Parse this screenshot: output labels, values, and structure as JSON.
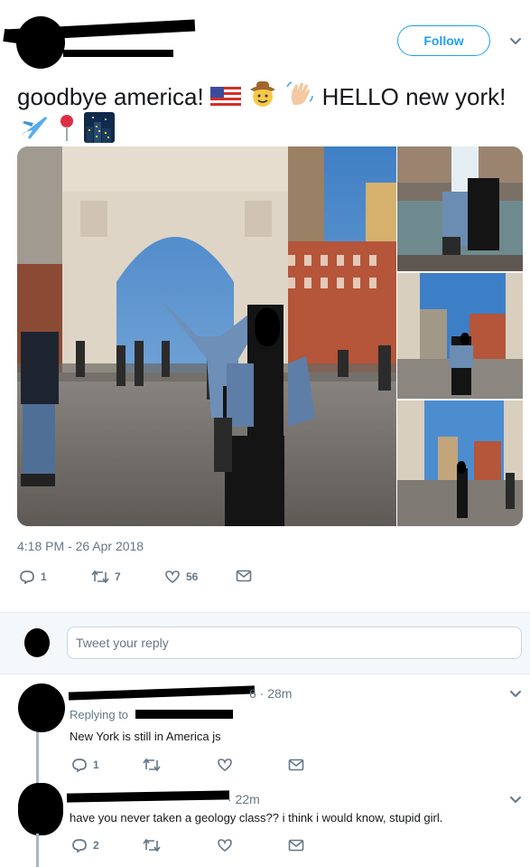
{
  "tweet": {
    "follow_label": "Follow",
    "text_a": "goodbye america! ",
    "text_b": " HELLO new york!",
    "timestamp": "4:18 PM - 26 Apr 2018",
    "reply_count": "1",
    "retweet_count": "7",
    "like_count": "56"
  },
  "reply_box": {
    "placeholder": "Tweet your reply"
  },
  "replies": [
    {
      "time": "6 · 28m",
      "replying_to_label": "Replying to",
      "text": "New York is still in America js",
      "reply_count": "1"
    },
    {
      "time": "· 22m",
      "text": "have you never taken a geology class?? i think i would know, stupid girl.",
      "reply_count": "2"
    }
  ],
  "icons": {
    "reply": "reply-icon",
    "retweet": "retweet-icon",
    "like": "heart-icon",
    "dm": "envelope-icon",
    "more": "chevron-down-icon"
  },
  "colors": {
    "accent": "#1da1f2",
    "muted": "#657786",
    "text": "#14171a"
  }
}
